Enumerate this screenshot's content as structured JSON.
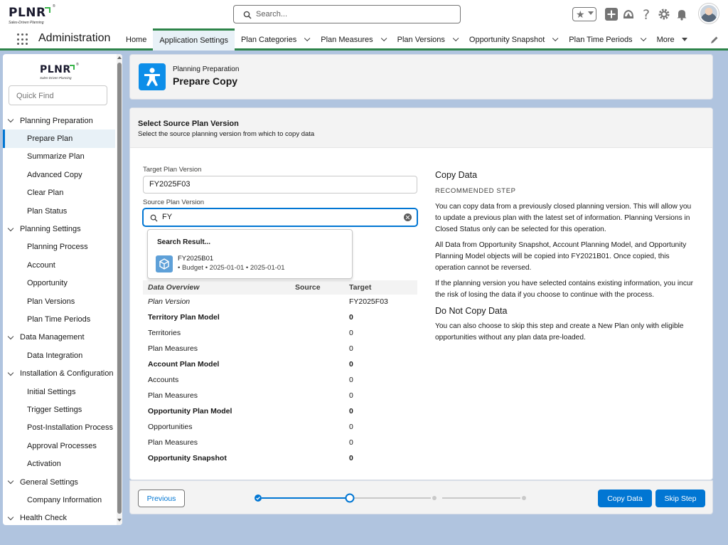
{
  "brand": {
    "logo_text": "PLNR",
    "logo_sub": "Sales-Driven Planning",
    "logo_reg": "®"
  },
  "search": {
    "placeholder": "Search..."
  },
  "app_nav": {
    "app_name": "Administration",
    "items": [
      {
        "label": "Home"
      },
      {
        "label": "Application Settings"
      },
      {
        "label": "Plan Categories"
      },
      {
        "label": "Plan Measures"
      },
      {
        "label": "Plan Versions"
      },
      {
        "label": "Opportunity Snapshot"
      },
      {
        "label": "Plan Time Periods"
      },
      {
        "label": "More"
      }
    ]
  },
  "sidebar": {
    "quick_find_placeholder": "Quick Find",
    "groups": [
      {
        "label": "Planning Preparation",
        "items": [
          "Prepare Plan",
          "Summarize Plan",
          "Advanced Copy",
          "Clear Plan",
          "Plan Status"
        ]
      },
      {
        "label": "Planning Settings",
        "items": [
          "Planning Process",
          "Account",
          "Opportunity",
          "Plan Versions",
          "Plan Time Periods"
        ]
      },
      {
        "label": "Data Management",
        "items": [
          "Data Integration"
        ]
      },
      {
        "label": "Installation & Configuration",
        "items": [
          "Initial Settings",
          "Trigger Settings",
          "Post-Installation Process",
          "Approval Processes",
          "Activation"
        ]
      },
      {
        "label": "General Settings",
        "items": [
          "Company Information"
        ]
      },
      {
        "label": "Health Check",
        "items": []
      }
    ]
  },
  "page_header": {
    "eyebrow": "Planning Preparation",
    "title": "Prepare Copy"
  },
  "section": {
    "title": "Select Source Plan Version",
    "subtitle": "Select the source planning version from which to copy data"
  },
  "form": {
    "target_label": "Target Plan Version",
    "target_value": "FY2025F03",
    "source_label": "Source Plan Version",
    "source_value": "FY"
  },
  "dropdown": {
    "heading": "Search Result...",
    "result_name": "FY2025B01",
    "result_meta": "• Budget •  2025-01-01 • 2025-01-01"
  },
  "overview": {
    "headers": {
      "name": "Data Overview",
      "source": "Source",
      "target": "Target"
    },
    "rows": [
      {
        "name": "Plan Version",
        "target": "FY2025F03"
      },
      {
        "name": "Territory Plan Model",
        "target": "0"
      },
      {
        "name": "Territories",
        "target": "0"
      },
      {
        "name": "Plan Measures",
        "target": "0"
      },
      {
        "name": "Account Plan Model",
        "target": "0"
      },
      {
        "name": "Accounts",
        "target": "0"
      },
      {
        "name": "Plan Measures",
        "target": "0"
      },
      {
        "name": "Opportunity Plan Model",
        "target": "0"
      },
      {
        "name": "Opportunities",
        "target": "0"
      },
      {
        "name": "Plan Measures",
        "target": "0"
      },
      {
        "name": "Opportunity Snapshot",
        "target": "0"
      }
    ]
  },
  "info": {
    "copy_heading": "Copy Data",
    "recommended": "RECOMMENDED STEP",
    "p1": "You can copy data from a previously closed planning version. This will allow you to update a previous plan with the latest set of information. Planning Versions in Closed Status only can be selected for this operation.",
    "p2": "All Data from Opportunity Snapshot, Account Planning Model, and Opportunity Planning Model objects will be copied into FY2021B01. Once copied, this operation cannot be reversed.",
    "p3": "If the planning version you have selected contains existing information, you incur the risk of losing the data if you choose to continue with the process.",
    "no_copy_heading": "Do Not Copy Data",
    "p4": "You can also choose to skip this step and create a New Plan only with eligible opportunities without any plan data pre-loaded."
  },
  "footer": {
    "previous_label": "Previous",
    "copy_label": "Copy Data",
    "skip_label": "Skip Step",
    "progress": {
      "steps": 4,
      "current_step": 2
    }
  },
  "colors": {
    "brand": "#0176d3",
    "nav_accent": "#2e844a",
    "header_icon": "#0d8ee9",
    "page_bg": "#b0c4df"
  }
}
